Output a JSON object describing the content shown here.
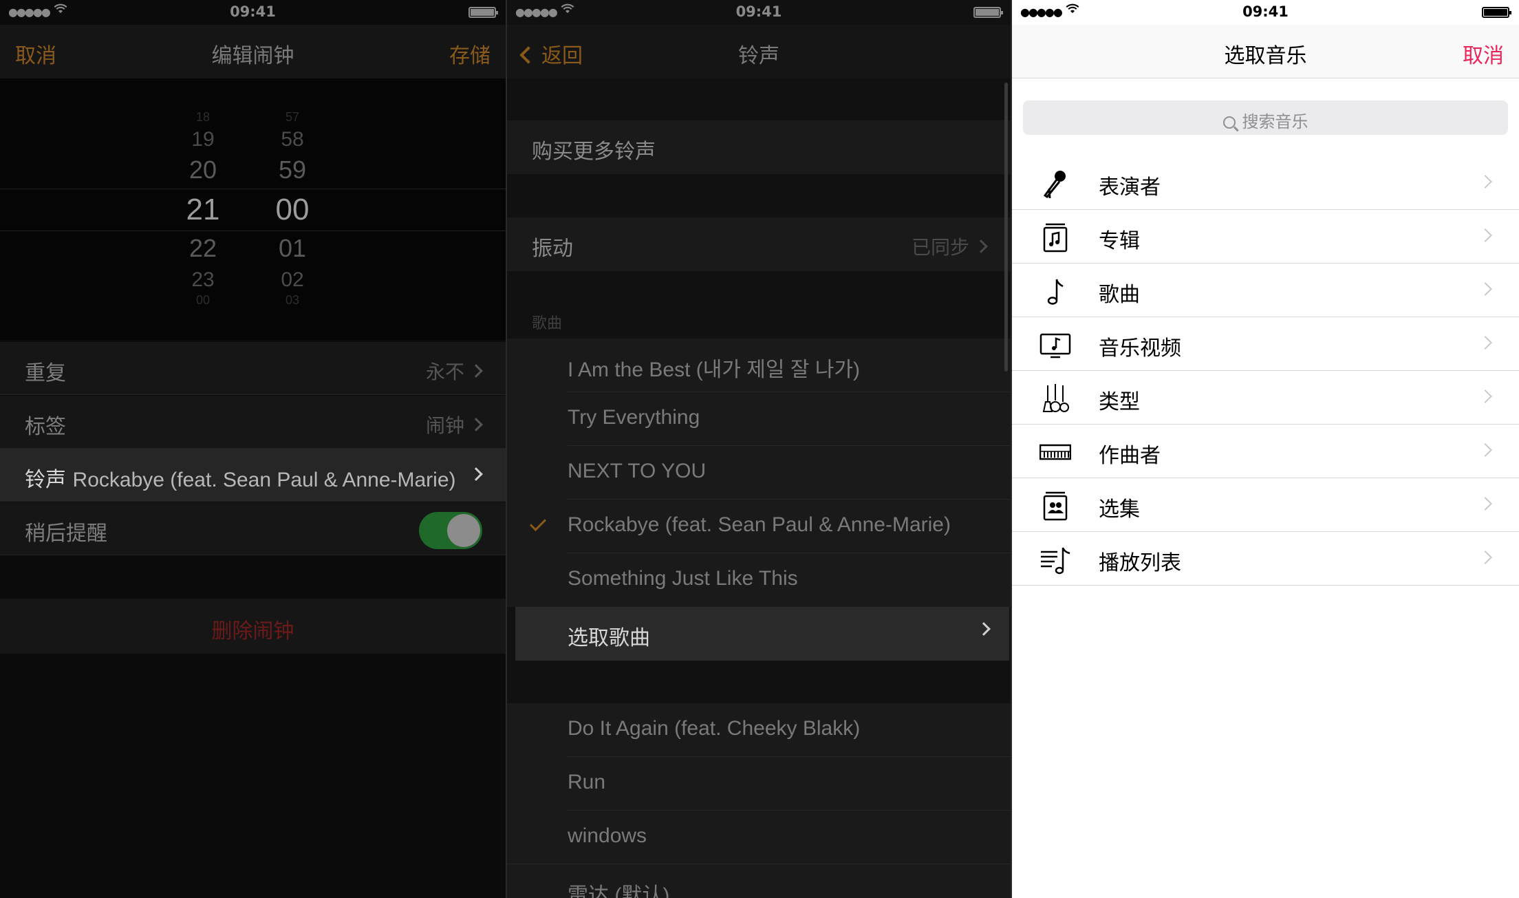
{
  "status": {
    "time": "09:41",
    "signal": "●●●●●"
  },
  "alarm_edit": {
    "nav": {
      "cancel": "取消",
      "title": "编辑闹钟",
      "save": "存储"
    },
    "picker": {
      "hours": [
        "18",
        "19",
        "20",
        "21",
        "22",
        "23",
        "00"
      ],
      "minutes": [
        "57",
        "58",
        "59",
        "00",
        "01",
        "02",
        "03"
      ],
      "selected_hour": "21",
      "selected_minute": "00"
    },
    "rows": {
      "repeat": {
        "label": "重复",
        "value": "永不"
      },
      "label": {
        "label": "标签",
        "value": "闹钟"
      },
      "sound": {
        "label": "铃声",
        "value": "Rockabye (feat. Sean Paul & Anne-Marie)"
      },
      "snooze": {
        "label": "稍后提醒",
        "on": true
      }
    },
    "delete": "删除闹钟"
  },
  "ringtone": {
    "nav": {
      "back": "返回",
      "title": "铃声"
    },
    "store": "购买更多铃声",
    "vibration": {
      "label": "振动",
      "value": "已同步"
    },
    "songs_header": "歌曲",
    "songs": [
      "I Am the Best (내가 제일 잘 나가)",
      "Try Everything",
      "NEXT TO YOU",
      "Rockabye (feat. Sean Paul & Anne-Marie)",
      "Something Just Like This"
    ],
    "selected_song": "Rockabye (feat. Sean Paul & Anne-Marie)",
    "pick_song": "选取歌曲",
    "tones": [
      "Do It Again (feat. Cheeky Blakk)",
      "Run",
      "windows",
      "雷达 (默认)"
    ]
  },
  "music_picker": {
    "nav": {
      "title": "选取音乐",
      "cancel": "取消"
    },
    "search_placeholder": "搜索音乐",
    "items": [
      {
        "label": "表演者",
        "icon": "microphone-icon"
      },
      {
        "label": "专辑",
        "icon": "album-icon"
      },
      {
        "label": "歌曲",
        "icon": "music-note-icon"
      },
      {
        "label": "音乐视频",
        "icon": "music-video-icon"
      },
      {
        "label": "类型",
        "icon": "guitars-icon"
      },
      {
        "label": "作曲者",
        "icon": "piano-icon"
      },
      {
        "label": "选集",
        "icon": "compilation-icon"
      },
      {
        "label": "播放列表",
        "icon": "playlist-icon"
      }
    ]
  },
  "colors": {
    "accent_dark": "#8a5a1a",
    "accent_light": "#e8265a",
    "delete": "#6b1a1a",
    "toggle_on": "#1f6a2a"
  }
}
